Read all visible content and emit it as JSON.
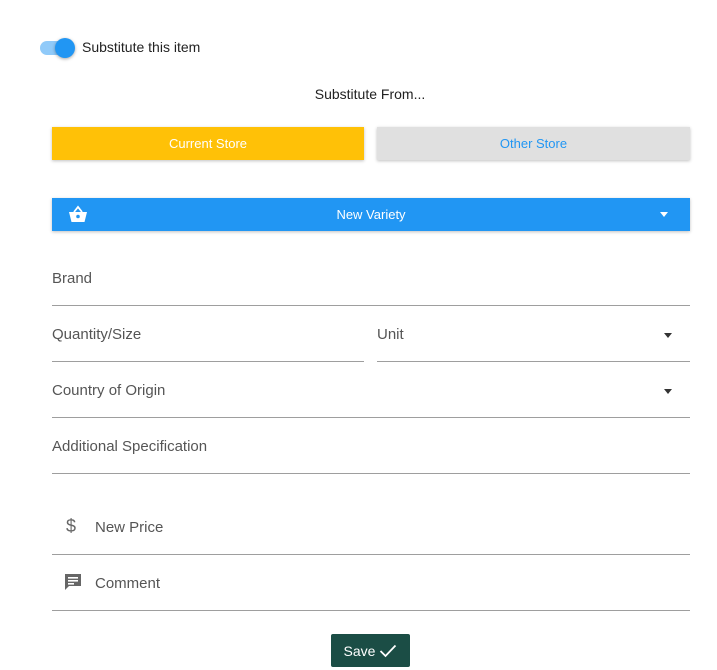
{
  "toggle": {
    "label": "Substitute this item",
    "on": true
  },
  "substitute_from": "Substitute From...",
  "store_buttons": {
    "current": "Current Store",
    "other": "Other Store"
  },
  "variety": {
    "label": "New Variety",
    "icon": "basket-icon"
  },
  "fields": {
    "brand": "Brand",
    "quantity": "Quantity/Size",
    "unit": "Unit",
    "country": "Country of Origin",
    "additional": "Additional Specification",
    "price": "New Price",
    "comment": "Comment"
  },
  "save": {
    "label": "Save"
  },
  "colors": {
    "primary": "#2196f3",
    "accent": "#ffc107",
    "save": "#1b4d45"
  }
}
